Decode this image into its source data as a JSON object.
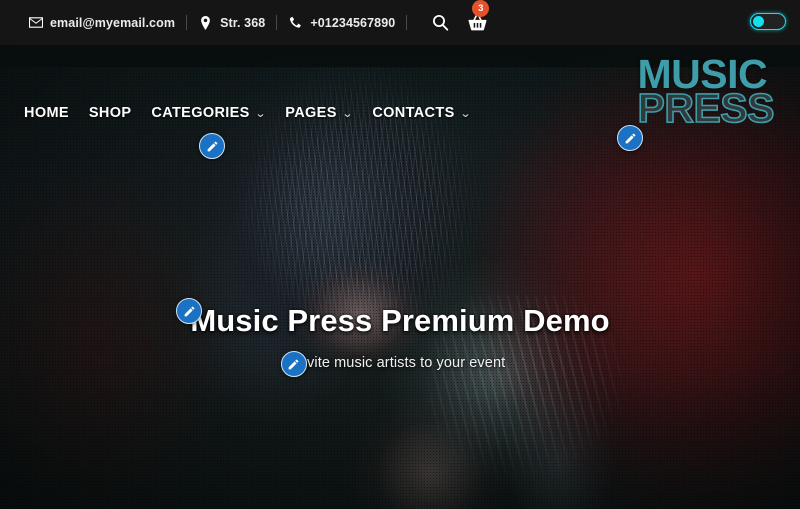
{
  "topbar": {
    "email": "email@myemail.com",
    "address": "Str. 368",
    "phone": "+01234567890",
    "email_icon": "envelope-icon",
    "address_icon": "map-pin-icon",
    "phone_icon": "phone-icon",
    "search_icon": "search-icon",
    "cart_icon": "shopping-basket-icon",
    "cart_count": "3",
    "cart_badge_color": "#e8502a",
    "toggle_state": "off",
    "toggle_accent": "#16e0ef",
    "background": "#151515"
  },
  "nav": {
    "items": [
      {
        "label": "HOME",
        "caret": ""
      },
      {
        "label": "SHOP",
        "caret": ""
      },
      {
        "label": "CATEGORIES",
        "caret": "⌄"
      },
      {
        "label": "PAGES",
        "caret": "⌄"
      },
      {
        "label": "CONTACTS",
        "caret": "⌄"
      }
    ]
  },
  "logo": {
    "line1": "MUSIC",
    "line2": "PRESS",
    "color": "#3f9da9"
  },
  "hero": {
    "title": "Music Press Premium Demo",
    "subtitle": "Invite music artists to your event",
    "background_description": "concert photo of singer with long dark hair at microphone under red stage lights"
  },
  "edit_badges": {
    "icon": "pencil-edit-icon",
    "color": "#1b72c4",
    "targets": [
      "nav",
      "logo",
      "hero-title",
      "hero-subtitle"
    ]
  }
}
